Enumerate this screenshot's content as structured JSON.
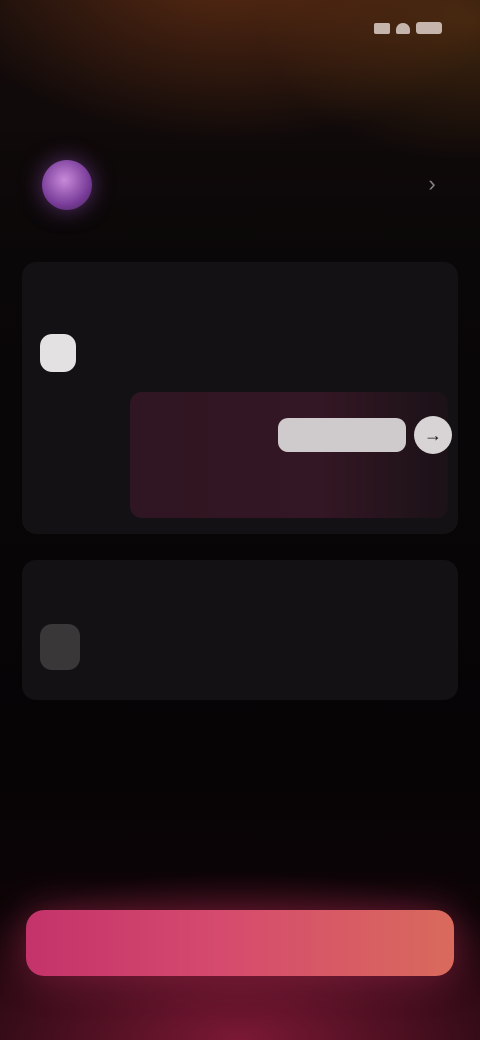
{
  "status_bar": {
    "time": "",
    "icons": [
      "signal-icon",
      "wifi-icon",
      "battery-icon"
    ]
  },
  "header": {
    "title": ""
  },
  "account": {
    "name": "",
    "subtitle": "",
    "chevron_icon": "chevron-right-icon"
  },
  "card_one": {
    "heading": "",
    "pill_label": "",
    "pill_side_text": "",
    "promo": {
      "text": "",
      "button_label": "",
      "arrow_icon": "arrow-right-icon",
      "caption_left": "",
      "caption_right": ""
    }
  },
  "card_two": {
    "heading": "",
    "pill_label": "",
    "pill_side_text": ""
  },
  "cta": {
    "label": ""
  },
  "colors": {
    "background": "#0b0708",
    "card": "#141114",
    "cta_start": "#c4336a",
    "cta_end": "#d96a5c",
    "avatar": "#7a3d9a"
  }
}
